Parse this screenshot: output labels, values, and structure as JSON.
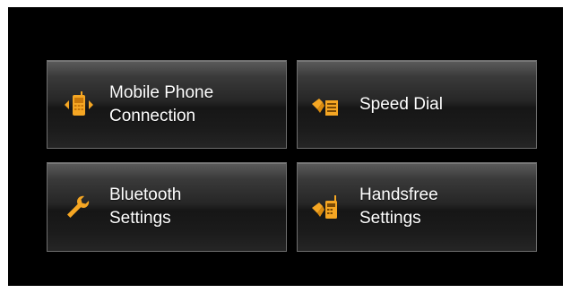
{
  "colors": {
    "background": "#000000",
    "accent": "#f5a623",
    "text": "#ffffff"
  },
  "menu": {
    "tiles": [
      {
        "lines": [
          "Mobile Phone",
          "Connection"
        ],
        "icon": "phone-connection-icon"
      },
      {
        "lines": [
          "Speed Dial"
        ],
        "icon": "speed-dial-icon"
      },
      {
        "lines": [
          "Bluetooth",
          "Settings"
        ],
        "icon": "wrench-icon"
      },
      {
        "lines": [
          "Handsfree",
          "Settings"
        ],
        "icon": "handsfree-icon"
      }
    ]
  }
}
